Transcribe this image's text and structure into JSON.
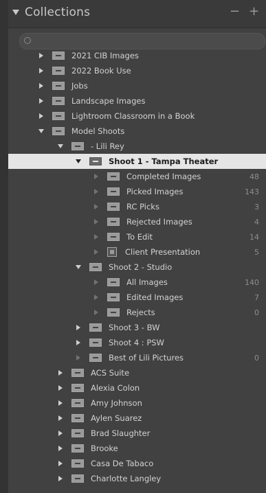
{
  "panel": {
    "title": "Collections",
    "minus": "−",
    "plus": "+"
  },
  "search": {
    "placeholder": ""
  },
  "tree": [
    {
      "label": "2021 CIB Images",
      "level": 0,
      "expand": "right",
      "count": ""
    },
    {
      "label": "2022 Book Use",
      "level": 0,
      "expand": "right",
      "count": ""
    },
    {
      "label": "Jobs",
      "level": 0,
      "expand": "right",
      "count": ""
    },
    {
      "label": "Landscape Images",
      "level": 0,
      "expand": "right",
      "count": ""
    },
    {
      "label": "Lightroom Classroom in a Book",
      "level": 0,
      "expand": "right",
      "count": ""
    },
    {
      "label": "Model Shoots",
      "level": 0,
      "expand": "down",
      "count": ""
    },
    {
      "label": "- Lili Rey",
      "level": 1,
      "expand": "down",
      "count": ""
    },
    {
      "label": "Shoot 1 - Tampa Theater",
      "level": 2,
      "expand": "down",
      "count": "",
      "selected": true
    },
    {
      "label": "Completed Images",
      "level": 3,
      "expand": "dim",
      "count": "48"
    },
    {
      "label": "Picked Images",
      "level": 3,
      "expand": "dim",
      "count": "143"
    },
    {
      "label": "RC Picks",
      "level": 3,
      "expand": "dim",
      "count": "3"
    },
    {
      "label": "Rejected Images",
      "level": 3,
      "expand": "dim",
      "count": "4"
    },
    {
      "label": "To Edit",
      "level": 3,
      "expand": "dim",
      "count": "14"
    },
    {
      "label": "Client Presentation",
      "level": 3,
      "expand": "dim",
      "count": "5",
      "smart": true
    },
    {
      "label": "Shoot 2 - Studio",
      "level": 2,
      "expand": "down",
      "count": ""
    },
    {
      "label": "All Images",
      "level": 3,
      "expand": "dim",
      "count": "140"
    },
    {
      "label": "Edited Images",
      "level": 3,
      "expand": "dim",
      "count": "7"
    },
    {
      "label": "Rejects",
      "level": 3,
      "expand": "dim",
      "count": "0"
    },
    {
      "label": "Shoot 3 - BW",
      "level": 2,
      "expand": "right",
      "count": ""
    },
    {
      "label": "Shoot 4 : PSW",
      "level": 2,
      "expand": "right",
      "count": ""
    },
    {
      "label": "Best of Lili Pictures",
      "level": 2,
      "expand": "dim",
      "count": "0"
    },
    {
      "label": "ACS Suite",
      "level": 1,
      "expand": "right",
      "count": ""
    },
    {
      "label": "Alexia Colon",
      "level": 1,
      "expand": "right",
      "count": ""
    },
    {
      "label": "Amy Johnson",
      "level": 1,
      "expand": "right",
      "count": ""
    },
    {
      "label": "Aylen Suarez",
      "level": 1,
      "expand": "right",
      "count": ""
    },
    {
      "label": "Brad Slaughter",
      "level": 1,
      "expand": "right",
      "count": ""
    },
    {
      "label": "Brooke",
      "level": 1,
      "expand": "right",
      "count": ""
    },
    {
      "label": "Casa De Tabaco",
      "level": 1,
      "expand": "right",
      "count": ""
    },
    {
      "label": "Charlotte Langley",
      "level": 1,
      "expand": "right",
      "count": ""
    }
  ],
  "colors": {
    "panel_bg": "#414141",
    "selected_bg": "#e5e5e5",
    "text": "#d2d2d2",
    "count": "#8e8e8e"
  }
}
